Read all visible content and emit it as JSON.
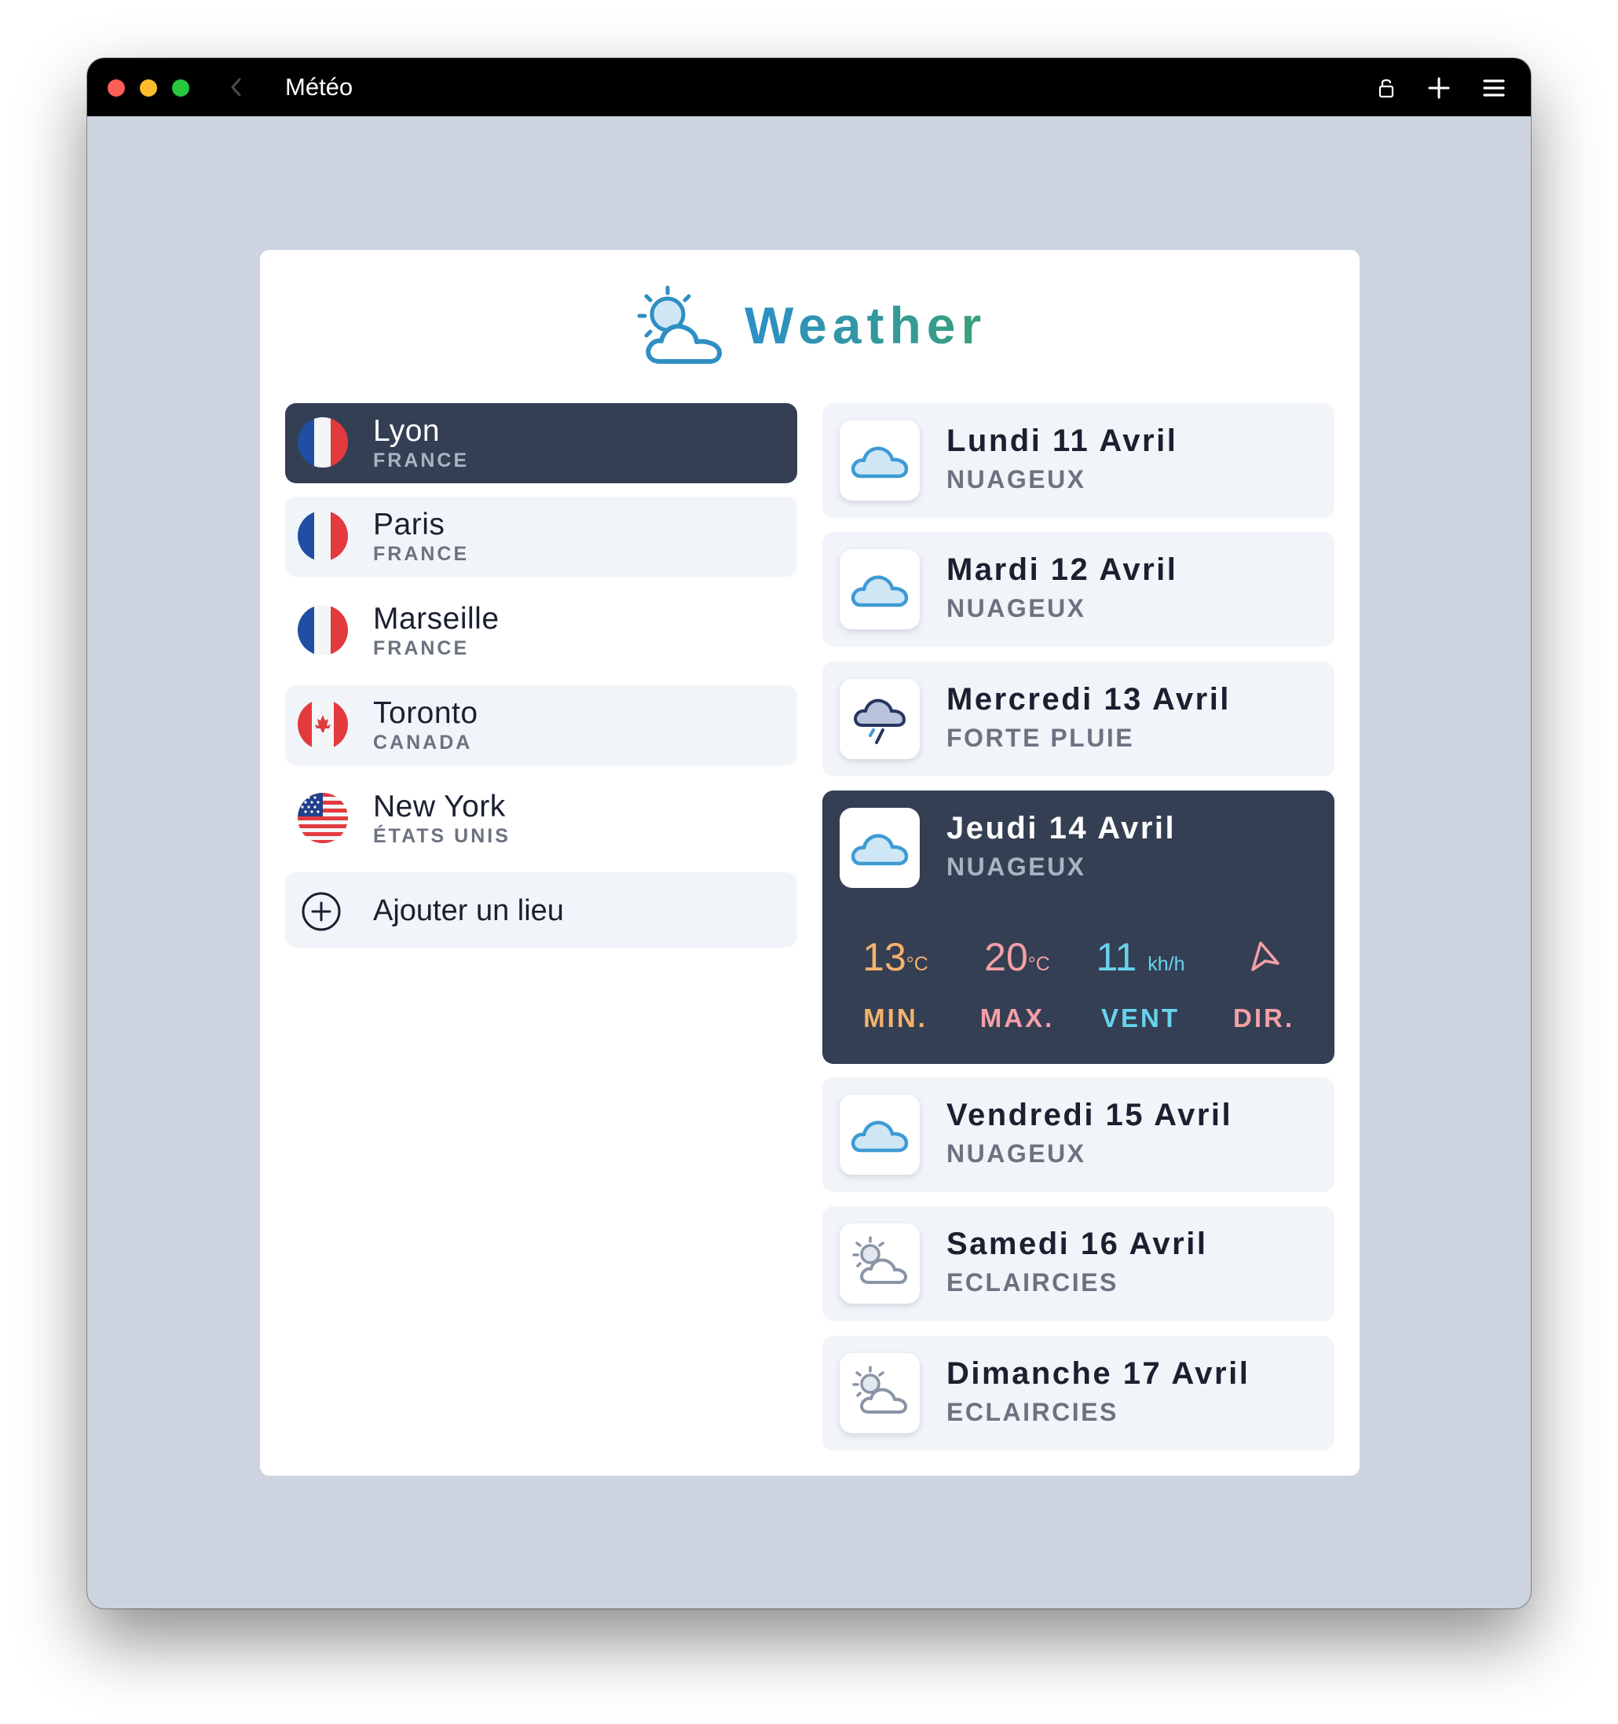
{
  "window": {
    "title": "Météo"
  },
  "app": {
    "name": "Weather"
  },
  "locations": [
    {
      "city": "Lyon",
      "country": "FRANCE",
      "flag": "france-flag",
      "selected": true
    },
    {
      "city": "Paris",
      "country": "FRANCE",
      "flag": "france-flag",
      "selected": false
    },
    {
      "city": "Marseille",
      "country": "FRANCE",
      "flag": "france-flag",
      "selected": false
    },
    {
      "city": "Toronto",
      "country": "CANADA",
      "flag": "canada-flag",
      "selected": false
    },
    {
      "city": "New York",
      "country": "ÉTATS UNIS",
      "flag": "usa-flag",
      "selected": false
    }
  ],
  "add_location": {
    "label": "Ajouter un lieu",
    "icon": "plus-circle-icon"
  },
  "forecast": [
    {
      "day": "Lundi 11 Avril",
      "condition": "NUAGEUX",
      "icon": "cloud-icon"
    },
    {
      "day": "Mardi 12 Avril",
      "condition": "NUAGEUX",
      "icon": "cloud-icon"
    },
    {
      "day": "Mercredi 13 Avril",
      "condition": "FORTE PLUIE",
      "icon": "heavy-rain-icon"
    },
    {
      "day": "Jeudi 14 Avril",
      "condition": "NUAGEUX",
      "icon": "cloud-icon",
      "selected": true,
      "details": {
        "min": {
          "value": "13",
          "unit": "°C",
          "label": "MIN."
        },
        "max": {
          "value": "20",
          "unit": "°C",
          "label": "MAX."
        },
        "wind": {
          "value": "11",
          "unit": "kh/h",
          "label": "VENT"
        },
        "direction": {
          "label": "DIR.",
          "icon": "navigation-arrow-icon"
        }
      }
    },
    {
      "day": "Vendredi 15 Avril",
      "condition": "NUAGEUX",
      "icon": "cloud-icon"
    },
    {
      "day": "Samedi 16 Avril",
      "condition": "ECLAIRCIES",
      "icon": "partly-sunny-icon"
    },
    {
      "day": "Dimanche 17 Avril",
      "condition": "ECLAIRCIES",
      "icon": "partly-sunny-icon"
    }
  ],
  "colors": {
    "accent_dark": "#353f53",
    "min": "#f6b26b",
    "max": "#f4a0a6",
    "wind": "#67d4ee",
    "direction": "#f4a0a6"
  }
}
